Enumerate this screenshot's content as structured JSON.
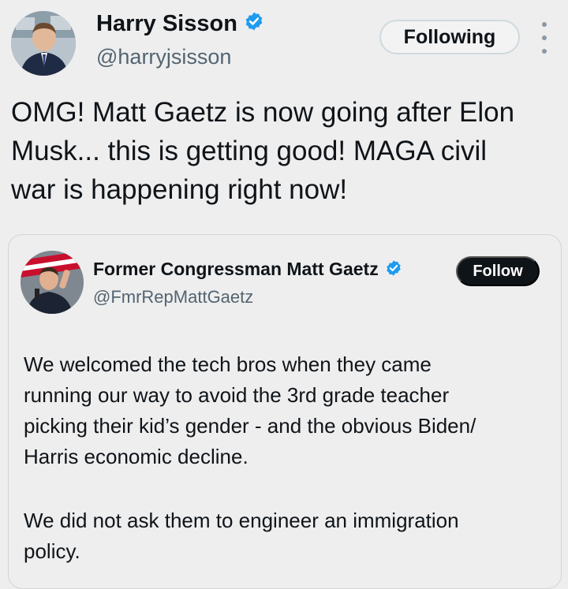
{
  "author": {
    "name": "Harry Sisson",
    "handle": "@harryjsisson",
    "verified_color": "#1d9bf0"
  },
  "follow_state_label": "Following",
  "more_icon": "more-vertical-icon",
  "tweet": {
    "lines": [
      "OMG! Matt Gaetz is now going after Elon",
      "Musk... this is getting good! MAGA civil",
      "war is happening right now!"
    ]
  },
  "quoted": {
    "name": "Former Congressman Matt Gaetz",
    "handle": "@FmrRepMattGaetz",
    "follow_label": "Follow",
    "paragraphs": [
      [
        "We welcomed the tech bros when they came",
        "running our way to avoid the 3rd grade teacher",
        "picking their kid’s gender - and the obvious Biden/",
        "Harris economic decline."
      ],
      [
        "We did not ask them to engineer an immigration",
        "policy."
      ]
    ]
  }
}
